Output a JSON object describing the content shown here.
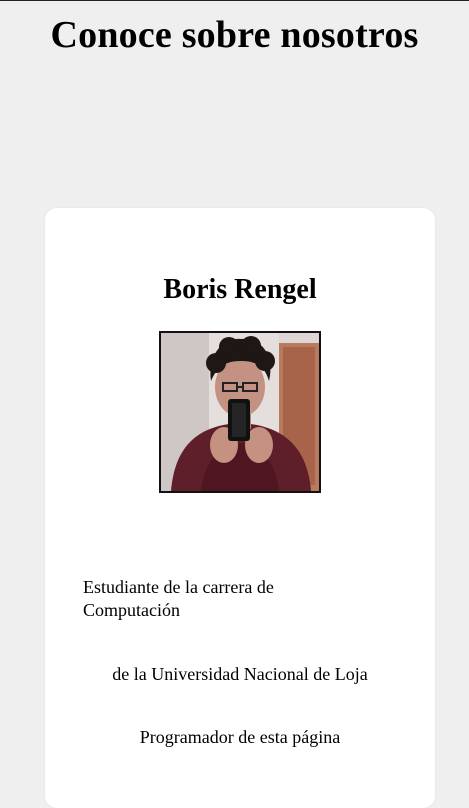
{
  "page": {
    "title": "Conoce sobre nosotros"
  },
  "profile": {
    "name": "Boris Rengel",
    "photo_alt": "Boris Rengel",
    "description_line1": "Estudiante de la carrera de Computación",
    "description_line2": "de la Universidad Nacional de Loja",
    "description_line3": "Programador de esta página"
  },
  "colors": {
    "background": "#efefef",
    "card": "#ffffff",
    "text": "#000000"
  }
}
